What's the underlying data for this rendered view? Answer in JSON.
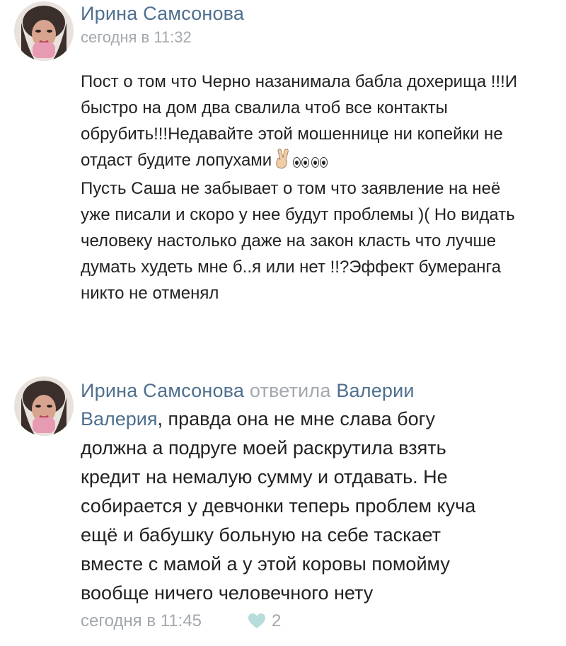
{
  "comment1": {
    "author": "Ирина Самсонова",
    "time": "сегодня в 11:32",
    "text_part1": "Пост о том что Черно назанимала бабла дохерища !!!И быстро на дом два свалила чтоб все контакты обрубить!!!Недавайте этой мошеннице ни копейки не отдаст будите лопухами",
    "emoji": [
      "victory-hand-emoji",
      "eyes-emoji",
      "eyes-emoji"
    ],
    "text_part2": "Пусть Саша не забывает о том что заявление на неё уже писали и скоро у нее будут проблемы )( Но видать человеку настолько даже на закон класть что лучше думать худеть мне б..я или нет !!?Эффект бумеранга никто не отменял"
  },
  "comment2": {
    "author": "Ирина Самсонова",
    "reply_verb": "ответила",
    "reply_to": "Валерии",
    "mention": "Валерия",
    "text": ", правда она не мне слава богу должна а подруге моей раскрутила взять кредит на немалую сумму и отдавать. Не собирается у девчонки теперь проблем куча ещё и бабушку больную на себе таскает вместе с мамой а у этой коровы помойму вообще ничего человечного нету",
    "time": "сегодня в 11:45",
    "likes": "2"
  },
  "colors": {
    "link": "#4f6f8f",
    "meta": "#a3a8ae",
    "like_heart": "#b7dcd9"
  }
}
